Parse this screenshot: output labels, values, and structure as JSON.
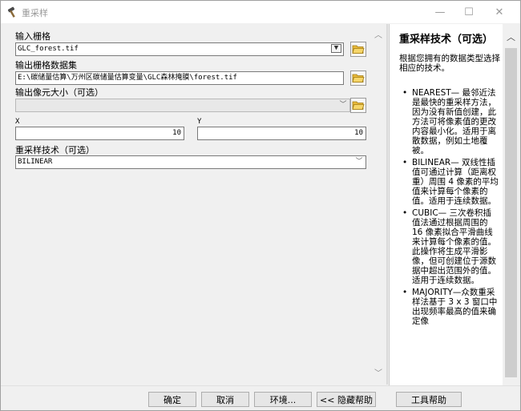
{
  "window": {
    "title": "重采样",
    "min_glyph": "—",
    "max_glyph": "☐",
    "close_glyph": "✕"
  },
  "form": {
    "input_raster": {
      "label": "输入栅格",
      "value": "GLC_forest.tif"
    },
    "output_raster": {
      "label": "输出栅格数据集",
      "value": "E:\\碳储量估算\\万州区碳储量估算变量\\GLC森林掩膜\\forest.tif"
    },
    "cell_size": {
      "label": "输出像元大小（可选）",
      "value": ""
    },
    "x": {
      "label": "X",
      "value": "10"
    },
    "y": {
      "label": "Y",
      "value": "10"
    },
    "resampling": {
      "label": "重采样技术（可选）",
      "value": "BILINEAR"
    }
  },
  "help": {
    "title": "重采样技术（可选）",
    "intro": "根据您拥有的数据类型选择相应的技术。",
    "items": [
      "NEAREST— 最邻近法是最快的重采样方法，因为没有新值创建，此方法可将像素值的更改内容最小化。适用于离散数据，例如土地覆被。",
      "BILINEAR— 双线性插值可通过计算（距离权重）周围 4 像素的平均值来计算每个像素的值。适用于连续数据。",
      "CUBIC— 三次卷积插值法通过根据周围的 16 像素拟合平滑曲线来计算每个像素的值。此操作将生成平滑影像，但可创建位于源数据中超出范围外的值。适用于连续数据。",
      "MAJORITY—众数重采样法基于 3 x 3 窗口中出现频率最高的值来确定像"
    ]
  },
  "buttons": {
    "ok": "确定",
    "cancel": "取消",
    "env": "环境...",
    "hide_help": "<< 隐藏帮助",
    "tool_help": "工具帮助"
  }
}
